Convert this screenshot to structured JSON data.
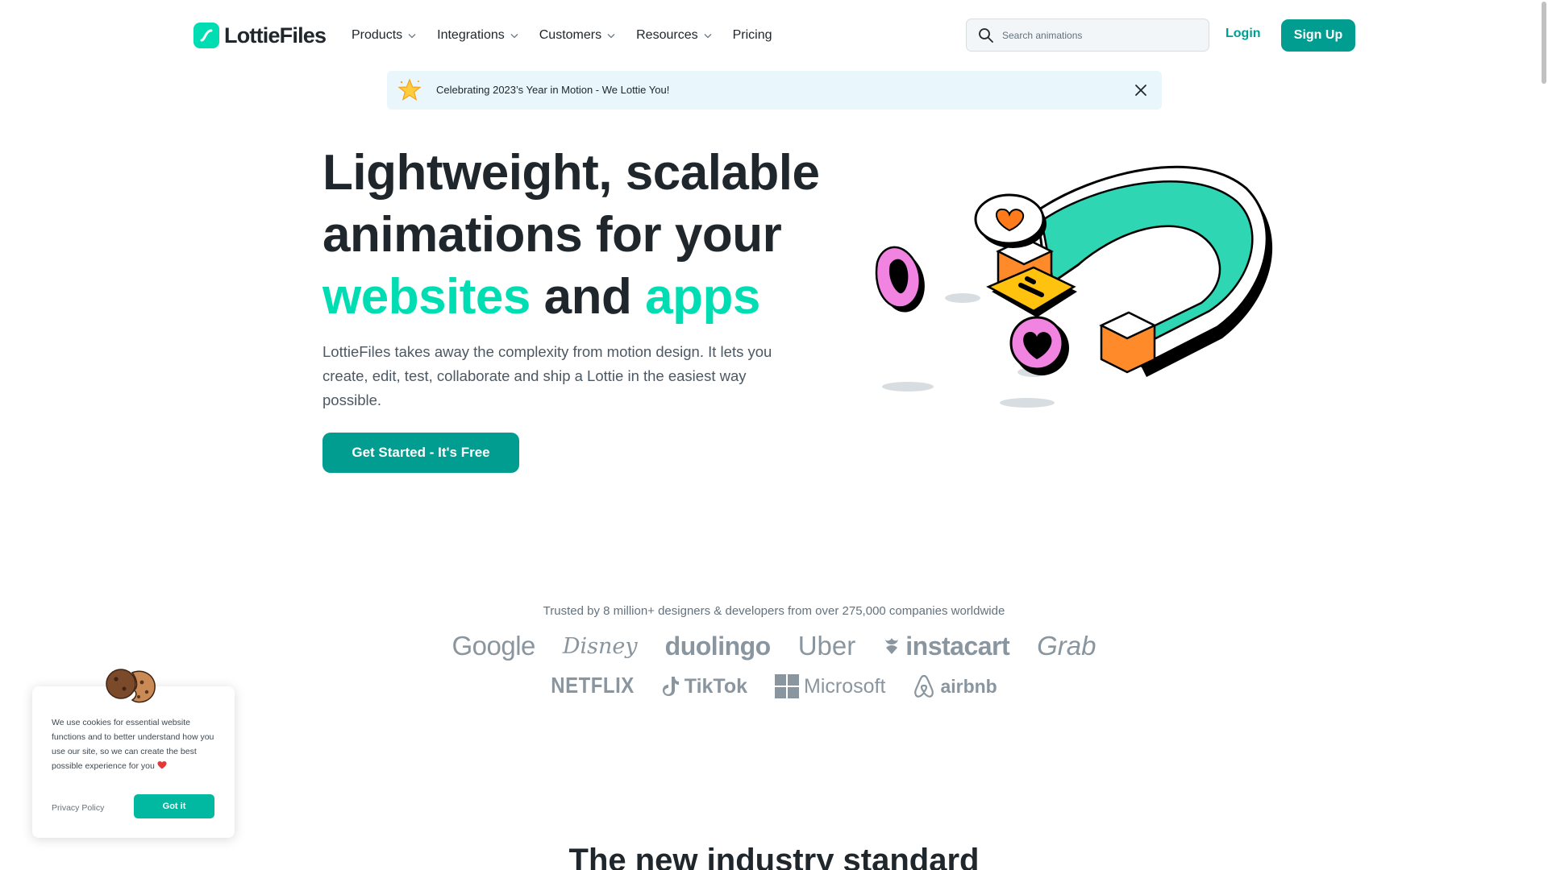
{
  "header": {
    "logo_text": "LottieFiles",
    "nav": [
      {
        "label": "Products",
        "has_dropdown": true
      },
      {
        "label": "Integrations",
        "has_dropdown": true
      },
      {
        "label": "Customers",
        "has_dropdown": true
      },
      {
        "label": "Resources",
        "has_dropdown": true
      },
      {
        "label": "Pricing",
        "has_dropdown": false
      }
    ],
    "search_placeholder": "Search animations",
    "login_label": "Login",
    "signup_label": "Sign Up"
  },
  "banner": {
    "text": "Celebrating 2023’s Year in Motion - We Lottie You!"
  },
  "hero": {
    "title_line1": "Lightweight, scalable",
    "title_line2": "animations for your",
    "title_word_websites": "websites",
    "title_word_and": "and",
    "title_word_apps": "apps",
    "description": "LottieFiles takes away the complexity from motion design. It lets you create, edit, test, collaborate and ship a Lottie in the easiest way possible.",
    "cta_label": "Get Started - It's Free"
  },
  "trust": {
    "text": "Trusted by 8 million+ designers & developers from over 275,000 companies worldwide",
    "logos_row1": [
      "Google",
      "Disney",
      "duolingo",
      "Uber",
      "instacart",
      "Grab"
    ],
    "logos_row2": [
      "NETFLIX",
      "TikTok",
      "Microsoft",
      "airbnb"
    ]
  },
  "next_section_title": "The new industry standard",
  "cookie": {
    "text": "We use cookies for essential website functions and to better understand how you use our site, so we can create the best possible experience for you",
    "policy_label": "Privacy Policy",
    "button_label": "Got it"
  },
  "colors": {
    "brand": "#019d91",
    "accent": "#00ddb3",
    "text": "#20272c",
    "banner_bg": "#e9f6fb"
  }
}
